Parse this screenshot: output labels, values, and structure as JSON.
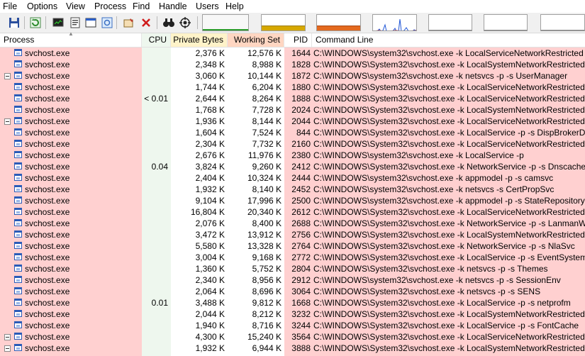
{
  "menu": [
    "File",
    "Options",
    "View",
    "Process",
    "Find",
    "Handle",
    "Users",
    "Help"
  ],
  "toolbar_icons": [
    "save-icon",
    "refresh-icon",
    "system-info-icon",
    "properties-icon",
    "window-icon",
    "handle-icon",
    "kill-process-icon",
    "kill-x-icon",
    "find-icon",
    "target-icon"
  ],
  "columns": {
    "process": "Process",
    "cpu": "CPU",
    "private_bytes": "Private Bytes",
    "working_set": "Working Set",
    "pid": "PID",
    "command_line": "Command Line"
  },
  "colors": {
    "service_row": "#ffd0d0",
    "cpu_column": "#eef7ee",
    "private_bytes_header": "#fff3c9",
    "working_set_header": "#ffd6c2",
    "cpu_graph": "#2c9c2c",
    "commit_graph": "#d6a800",
    "physical_graph": "#e46a1f",
    "io_graph": "#1f55d6"
  },
  "processes": [
    {
      "name": "svchost.exe",
      "cpu": "",
      "private_bytes": "2,376 K",
      "working_set": "12,576 K",
      "pid": "1644",
      "command_line": "C:\\WINDOWS\\system32\\svchost.exe -k LocalServiceNetworkRestricted -p -s Tim",
      "expand": false
    },
    {
      "name": "svchost.exe",
      "cpu": "",
      "private_bytes": "2,348 K",
      "working_set": "8,988 K",
      "pid": "1828",
      "command_line": "C:\\WINDOWS\\System32\\svchost.exe -k LocalSystemNetworkRestricted -p -s Disp",
      "expand": false
    },
    {
      "name": "svchost.exe",
      "cpu": "",
      "private_bytes": "3,060 K",
      "working_set": "10,144 K",
      "pid": "1872",
      "command_line": "C:\\WINDOWS\\system32\\svchost.exe -k netsvcs -p -s UserManager",
      "expand": true
    },
    {
      "name": "svchost.exe",
      "cpu": "",
      "private_bytes": "1,744 K",
      "working_set": "6,204 K",
      "pid": "1880",
      "command_line": "C:\\WINDOWS\\System32\\svchost.exe -k LocalServiceNetworkRestricted -p -s hid",
      "expand": false
    },
    {
      "name": "svchost.exe",
      "cpu": "< 0.01",
      "private_bytes": "2,644 K",
      "working_set": "8,264 K",
      "pid": "1888",
      "command_line": "C:\\WINDOWS\\System32\\svchost.exe -k LocalServiceNetworkRestricted -p -s Dh",
      "expand": false
    },
    {
      "name": "svchost.exe",
      "cpu": "",
      "private_bytes": "1,768 K",
      "working_set": "7,728 K",
      "pid": "2024",
      "command_line": "C:\\WINDOWS\\System32\\svchost.exe -k LocalSystemNetworkRestricted -p -s Ur",
      "expand": false
    },
    {
      "name": "svchost.exe",
      "cpu": "",
      "private_bytes": "1,936 K",
      "working_set": "8,144 K",
      "pid": "2044",
      "command_line": "C:\\WINDOWS\\System32\\svchost.exe -k LocalServiceNetworkRestricted -p -s Ta",
      "expand": true
    },
    {
      "name": "svchost.exe",
      "cpu": "",
      "private_bytes": "1,604 K",
      "working_set": "7,524 K",
      "pid": "844",
      "command_line": "C:\\WINDOWS\\System32\\svchost.exe -k LocalService -p -s DispBrokerDesktopS",
      "expand": false
    },
    {
      "name": "svchost.exe",
      "cpu": "",
      "private_bytes": "2,304 K",
      "working_set": "7,732 K",
      "pid": "2160",
      "command_line": "C:\\WINDOWS\\System32\\svchost.exe -k LocalServiceNetworkRestricted -p -s W",
      "expand": false
    },
    {
      "name": "svchost.exe",
      "cpu": "",
      "private_bytes": "2,676 K",
      "working_set": "11,976 K",
      "pid": "2380",
      "command_line": "C:\\WINDOWS\\system32\\svchost.exe -k LocalService -p",
      "expand": false
    },
    {
      "name": "svchost.exe",
      "cpu": "0.04",
      "private_bytes": "3,824 K",
      "working_set": "9,260 K",
      "pid": "2412",
      "command_line": "C:\\WINDOWS\\System32\\svchost.exe -k NetworkService -p -s Dnscache",
      "expand": false
    },
    {
      "name": "svchost.exe",
      "cpu": "",
      "private_bytes": "2,404 K",
      "working_set": "10,324 K",
      "pid": "2444",
      "command_line": "C:\\WINDOWS\\system32\\svchost.exe -k appmodel -p -s camsvc",
      "expand": false
    },
    {
      "name": "svchost.exe",
      "cpu": "",
      "private_bytes": "1,932 K",
      "working_set": "8,140 K",
      "pid": "2452",
      "command_line": "C:\\WINDOWS\\system32\\svchost.exe -k netsvcs -s CertPropSvc",
      "expand": false
    },
    {
      "name": "svchost.exe",
      "cpu": "",
      "private_bytes": "9,104 K",
      "working_set": "17,996 K",
      "pid": "2500",
      "command_line": "C:\\WINDOWS\\system32\\svchost.exe -k appmodel -p -s StateRepository",
      "expand": false
    },
    {
      "name": "svchost.exe",
      "cpu": "",
      "private_bytes": "16,804 K",
      "working_set": "20,340 K",
      "pid": "2612",
      "command_line": "C:\\WINDOWS\\System32\\svchost.exe -k LocalServiceNetworkRestricted -p -s Ev",
      "expand": false
    },
    {
      "name": "svchost.exe",
      "cpu": "",
      "private_bytes": "2,076 K",
      "working_set": "8,400 K",
      "pid": "2688",
      "command_line": "C:\\WINDOWS\\System32\\svchost.exe -k NetworkService -p -s LanmanWorkstati",
      "expand": false
    },
    {
      "name": "svchost.exe",
      "cpu": "",
      "private_bytes": "3,472 K",
      "working_set": "13,912 K",
      "pid": "2756",
      "command_line": "C:\\WINDOWS\\System32\\svchost.exe -k LocalSystemNetworkRestricted -p -s Sy",
      "expand": false
    },
    {
      "name": "svchost.exe",
      "cpu": "",
      "private_bytes": "5,580 K",
      "working_set": "13,328 K",
      "pid": "2764",
      "command_line": "C:\\WINDOWS\\System32\\svchost.exe -k NetworkService -p -s NlaSvc",
      "expand": false
    },
    {
      "name": "svchost.exe",
      "cpu": "",
      "private_bytes": "3,004 K",
      "working_set": "9,168 K",
      "pid": "2772",
      "command_line": "C:\\WINDOWS\\System32\\svchost.exe -k LocalService -p -s EventSystem",
      "expand": false
    },
    {
      "name": "svchost.exe",
      "cpu": "",
      "private_bytes": "1,360 K",
      "working_set": "5,752 K",
      "pid": "2804",
      "command_line": "C:\\WINDOWS\\System32\\svchost.exe -k netsvcs -p -s Themes",
      "expand": false
    },
    {
      "name": "svchost.exe",
      "cpu": "",
      "private_bytes": "2,340 K",
      "working_set": "8,956 K",
      "pid": "2912",
      "command_line": "C:\\WINDOWS\\system32\\svchost.exe -k netsvcs -p -s SessionEnv",
      "expand": false
    },
    {
      "name": "svchost.exe",
      "cpu": "",
      "private_bytes": "2,064 K",
      "working_set": "8,696 K",
      "pid": "3064",
      "command_line": "C:\\WINDOWS\\System32\\svchost.exe -k netsvcs -p -s SENS",
      "expand": false
    },
    {
      "name": "svchost.exe",
      "cpu": "0.01",
      "private_bytes": "3,488 K",
      "working_set": "9,812 K",
      "pid": "1668",
      "command_line": "C:\\WINDOWS\\System32\\svchost.exe -k LocalService -p -s netprofm",
      "expand": false
    },
    {
      "name": "svchost.exe",
      "cpu": "",
      "private_bytes": "2,044 K",
      "working_set": "8,212 K",
      "pid": "3232",
      "command_line": "C:\\WINDOWS\\System32\\svchost.exe -k LocalSystemNetworkRestricted -p -s Au",
      "expand": false
    },
    {
      "name": "svchost.exe",
      "cpu": "",
      "private_bytes": "1,940 K",
      "working_set": "8,716 K",
      "pid": "3244",
      "command_line": "C:\\WINDOWS\\System32\\svchost.exe -k LocalService -p -s FontCache",
      "expand": false
    },
    {
      "name": "svchost.exe",
      "cpu": "",
      "private_bytes": "4,300 K",
      "working_set": "15,240 K",
      "pid": "3564",
      "command_line": "C:\\WINDOWS\\System32\\svchost.exe -k LocalServiceNetworkRestricted -p",
      "expand": true
    },
    {
      "name": "svchost.exe",
      "cpu": "",
      "private_bytes": "1,932 K",
      "working_set": "6,944 K",
      "pid": "3888",
      "command_line": "C:\\WINDOWS\\System32\\svchost.exe -k LocalSystemNetworkRestricted -p",
      "expand": true
    }
  ]
}
